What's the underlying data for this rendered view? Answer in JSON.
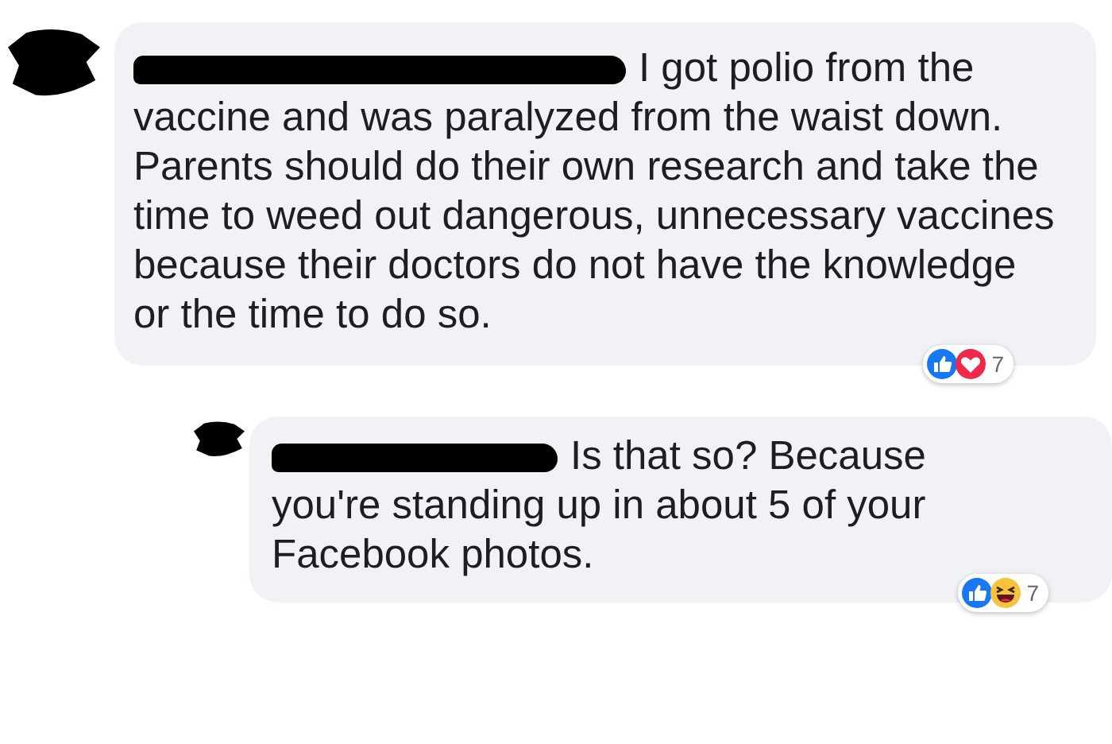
{
  "comments": [
    {
      "text": "I got polio from the vaccine and was paralyzed from the waist down. Parents should do their own research and take the time to weed out dangerous, unnecessary vaccines because their doctors do not have the knowledge or the time to do so.",
      "reply": false,
      "reactions": [
        {
          "kind": "like"
        },
        {
          "kind": "love"
        }
      ],
      "reaction_count": "7"
    },
    {
      "text": "Is that so? Because you're standing up in about 5 of your Facebook photos.",
      "reply": true,
      "reactions": [
        {
          "kind": "like"
        },
        {
          "kind": "haha"
        }
      ],
      "reaction_count": "7"
    }
  ]
}
